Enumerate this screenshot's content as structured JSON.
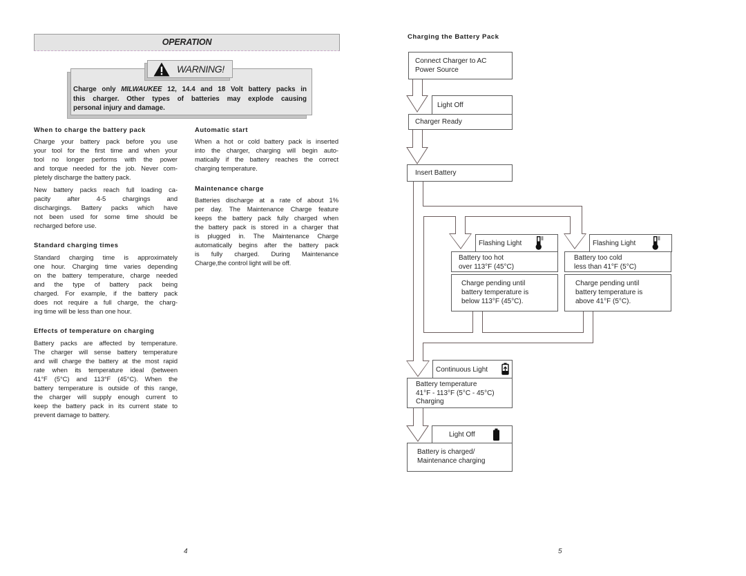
{
  "left_page": {
    "header": "OPERATION",
    "warning": {
      "label": "WARNING!",
      "icon": "warning-triangle-icon",
      "line1_before": "Charge only ",
      "brand": "MILWAUKEE",
      "line1_after": " 12, 14.4 and 18 Volt battery packs in",
      "line2": "this charger. Other types of batteries may explode causing",
      "line3": "personal injury and damage."
    },
    "col1": [
      {
        "heading": "When to charge the battery pack",
        "paragraphs": [
          [
            "Charge your battery pack before you use",
            "your tool for the first time and when your",
            "tool no longer performs with the power",
            "and torque needed for the job.  Never com-",
            "pletely discharge the battery pack."
          ],
          [
            "New battery packs reach full loading ca-",
            "pacity after 4-5 chargings and",
            "dischargings.  Battery packs which have",
            "not been used for some time should be",
            "recharged before use."
          ]
        ]
      },
      {
        "heading": "Standard charging times",
        "paragraphs": [
          [
            "Standard charging time is approximately",
            "one hour.  Charging time varies depending",
            "on the battery temperature, charge needed",
            "and the type of battery pack being",
            "charged.  For example, if the battery pack",
            "does not require a full charge, the charg-",
            "ing time will be less than one hour."
          ]
        ]
      },
      {
        "heading": "Effects of temperature on charging",
        "paragraphs": [
          [
            "Battery packs are affected by temperature.",
            "The charger will sense battery temperature",
            "and will charge the battery at the most rapid",
            "rate when its temperature ideal (between",
            "41°F (5°C) and 113°F (45°C).  When the",
            "battery temperature is outside of this range,",
            "the charger will supply enough current to",
            "keep the battery pack in its current state to",
            "prevent damage to battery."
          ]
        ]
      }
    ],
    "col2": [
      {
        "heading": "Automatic start",
        "paragraphs": [
          [
            "When a hot or cold battery pack is inserted",
            "into the charger, charging will begin auto-",
            "matically if the battery reaches the correct",
            "charging temperature."
          ]
        ]
      },
      {
        "heading": "Maintenance charge",
        "paragraphs": [
          [
            "Batteries discharge at a rate of about 1%",
            "per day. The Maintenance Charge feature",
            "keeps the battery pack fully charged when",
            "the battery pack is stored in a charger that",
            "is plugged in.  The Maintenance Charge",
            "automatically begins after the battery pack",
            "is fully charged. During Maintenance",
            "Charge,the control light will be off."
          ]
        ]
      }
    ],
    "page_number": "4"
  },
  "right_page": {
    "title": "Charging the Battery Pack",
    "steps": {
      "connect": [
        "Connect Charger to AC",
        "Power Source"
      ],
      "ready_indicator": "Light Off",
      "charger_ready": "Charger Ready",
      "insert": "Insert Battery",
      "hot_indicator": "Flashing Light",
      "hot_state": [
        "Battery too hot",
        "over 113°F (45°C)"
      ],
      "hot_pending": [
        "Charge pending until",
        "battery temperature is",
        "below  113°F (45°C)."
      ],
      "cold_indicator": "Flashing Light",
      "cold_state": [
        "Battery too cold",
        "less than 41°F (5°C)"
      ],
      "cold_pending": [
        "Charge pending until",
        "battery temperature is",
        "above  41°F (5°C)."
      ],
      "charging_indicator": "Continuous Light",
      "charging_state": [
        "Battery temperature",
        "41°F  - 113°F (5°C - 45°C)",
        "Charging"
      ],
      "done_indicator": "Light Off",
      "done_state": [
        "Battery is charged/",
        "Maintenance charging"
      ]
    },
    "icons": {
      "temperature": "thermometer-icon",
      "charging": "battery-charging-icon",
      "charged": "battery-full-icon"
    },
    "page_number": "5"
  }
}
